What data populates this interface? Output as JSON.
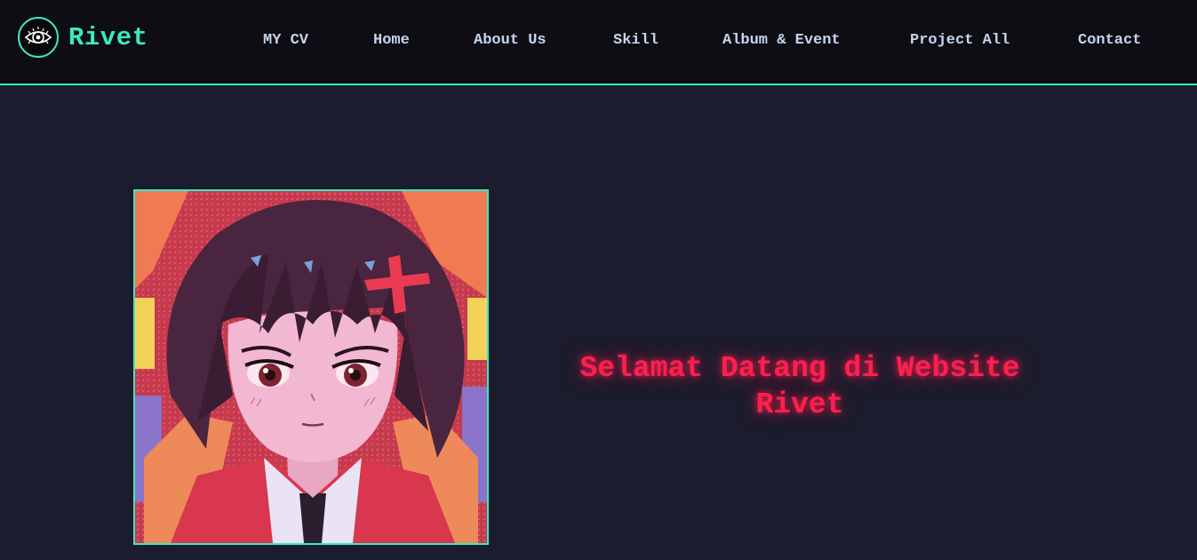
{
  "brand": {
    "name": "Rivet",
    "logo_icon": "eye-icon"
  },
  "nav": {
    "items": [
      {
        "label": "MY CV"
      },
      {
        "label": "Home"
      },
      {
        "label": "About Us"
      },
      {
        "label": "Skill"
      },
      {
        "label": "Album & Event"
      },
      {
        "label": "Project All"
      },
      {
        "label": "Contact"
      }
    ]
  },
  "hero": {
    "welcome_text": "Selamat Datang di Website Rivet",
    "image_description_icon": "anime-portrait-illustration"
  },
  "colors": {
    "accent": "#3de8c3",
    "nav_bg": "#0d0d13",
    "page_bg": "#1b1c2d",
    "nav_text": "#c7d4ef",
    "welcome_text": "#ff1f4f"
  }
}
